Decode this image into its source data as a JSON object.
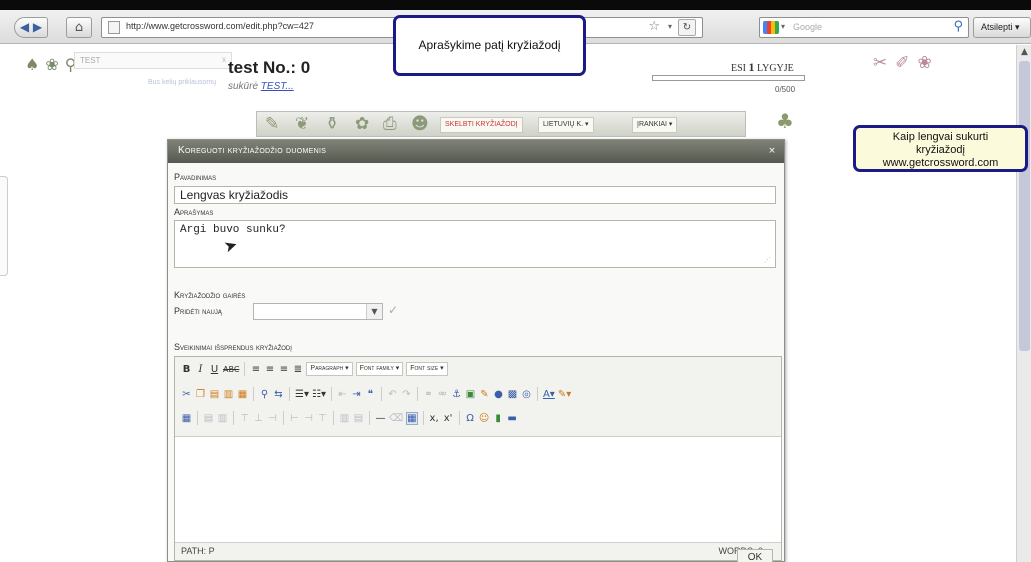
{
  "browser": {
    "back_icon": "back-forward-icon",
    "home_icon": "home-icon",
    "url": "http://www.getcrossword.com/edit.php?cw=427",
    "search_placeholder": "Google",
    "bookmarks_label": "Atsilepti ▾"
  },
  "annotations": {
    "top_callout": "Aprašykime patį kryžiažodį",
    "right_callout_line1": "Kaip lengvai sukurti",
    "right_callout_line2": "kryžiažodį",
    "right_callout_line3": "www.getcrossword.com"
  },
  "header": {
    "mini_input_value": "TEST",
    "mini_input_close": "x",
    "faint_text": "Bus kelių priklausomų",
    "test_title": "test No.: 0",
    "author_prefix": "sukūrė ",
    "author_link": "TEST...",
    "level_prefix": "ESI ",
    "level_number": "1",
    "level_suffix": " LYGYJE",
    "progress_label": "0/500",
    "progress_fraction": 0.0
  },
  "site_toolbar": {
    "publish_label": "SKELBTI KRYŽIAŽODĮ",
    "language_label": "LIETUVIŲ K. ▾",
    "tools_label": "ĮRANKIAI ▾"
  },
  "dialog": {
    "title": "Koreguoti kryžiažodžio duomenis",
    "close": "×",
    "name_label": "Pavadinimas",
    "name_value": "Lengvas kryžiažodis",
    "description_label": "Aprašymas",
    "description_value": "Argi buvo sunku?",
    "guidelines_label": "Kryžiažodžio gairės",
    "add_new_label": "Pridėti naują",
    "greetings_label": "Sveikinimai išsprendus kryžiažodį",
    "editor": {
      "paragraph_select": "Paragraph ▾",
      "font_family_select": "Font family ▾",
      "font_size_select": "Font size ▾",
      "status_path": "PATH: P",
      "word_count": "WORDS: 0"
    },
    "ok_label": "OK"
  }
}
